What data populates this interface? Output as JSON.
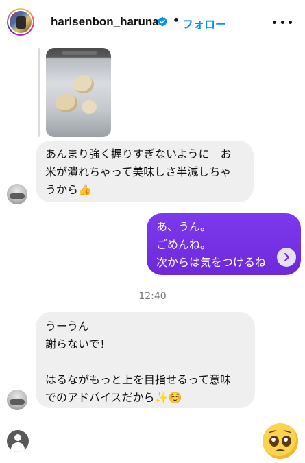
{
  "header": {
    "username": "harisenbon_haruna",
    "separator": "•",
    "follow_label": "フォロー"
  },
  "messages": [
    {
      "direction": "incoming",
      "text": "あんまり強く握りすぎないように　お\n米が潰れちゃって美味しさ半減しちゃ\nうから👍"
    },
    {
      "direction": "outgoing",
      "text": "あ、うん。\nごめんね。\n次からは気をつけるね"
    },
    {
      "direction": "incoming",
      "text": "うーうん\n謝らないで！\n\nはるながもっと上を目指せるって意味\nでのアドバイスだから✨☺️"
    }
  ],
  "timestamp": "12:40",
  "colors": {
    "outgoing_bubble": "#7c3aed",
    "incoming_bubble": "#efefef",
    "follow_link": "#0095f6",
    "verified_badge": "#0095f6"
  },
  "icons": {
    "verified": "verified-badge-icon",
    "more": "more-options-icon",
    "reply": "reply-icon",
    "profile": "user-silhouette-icon",
    "reaction": "pleading-face-emoji"
  }
}
